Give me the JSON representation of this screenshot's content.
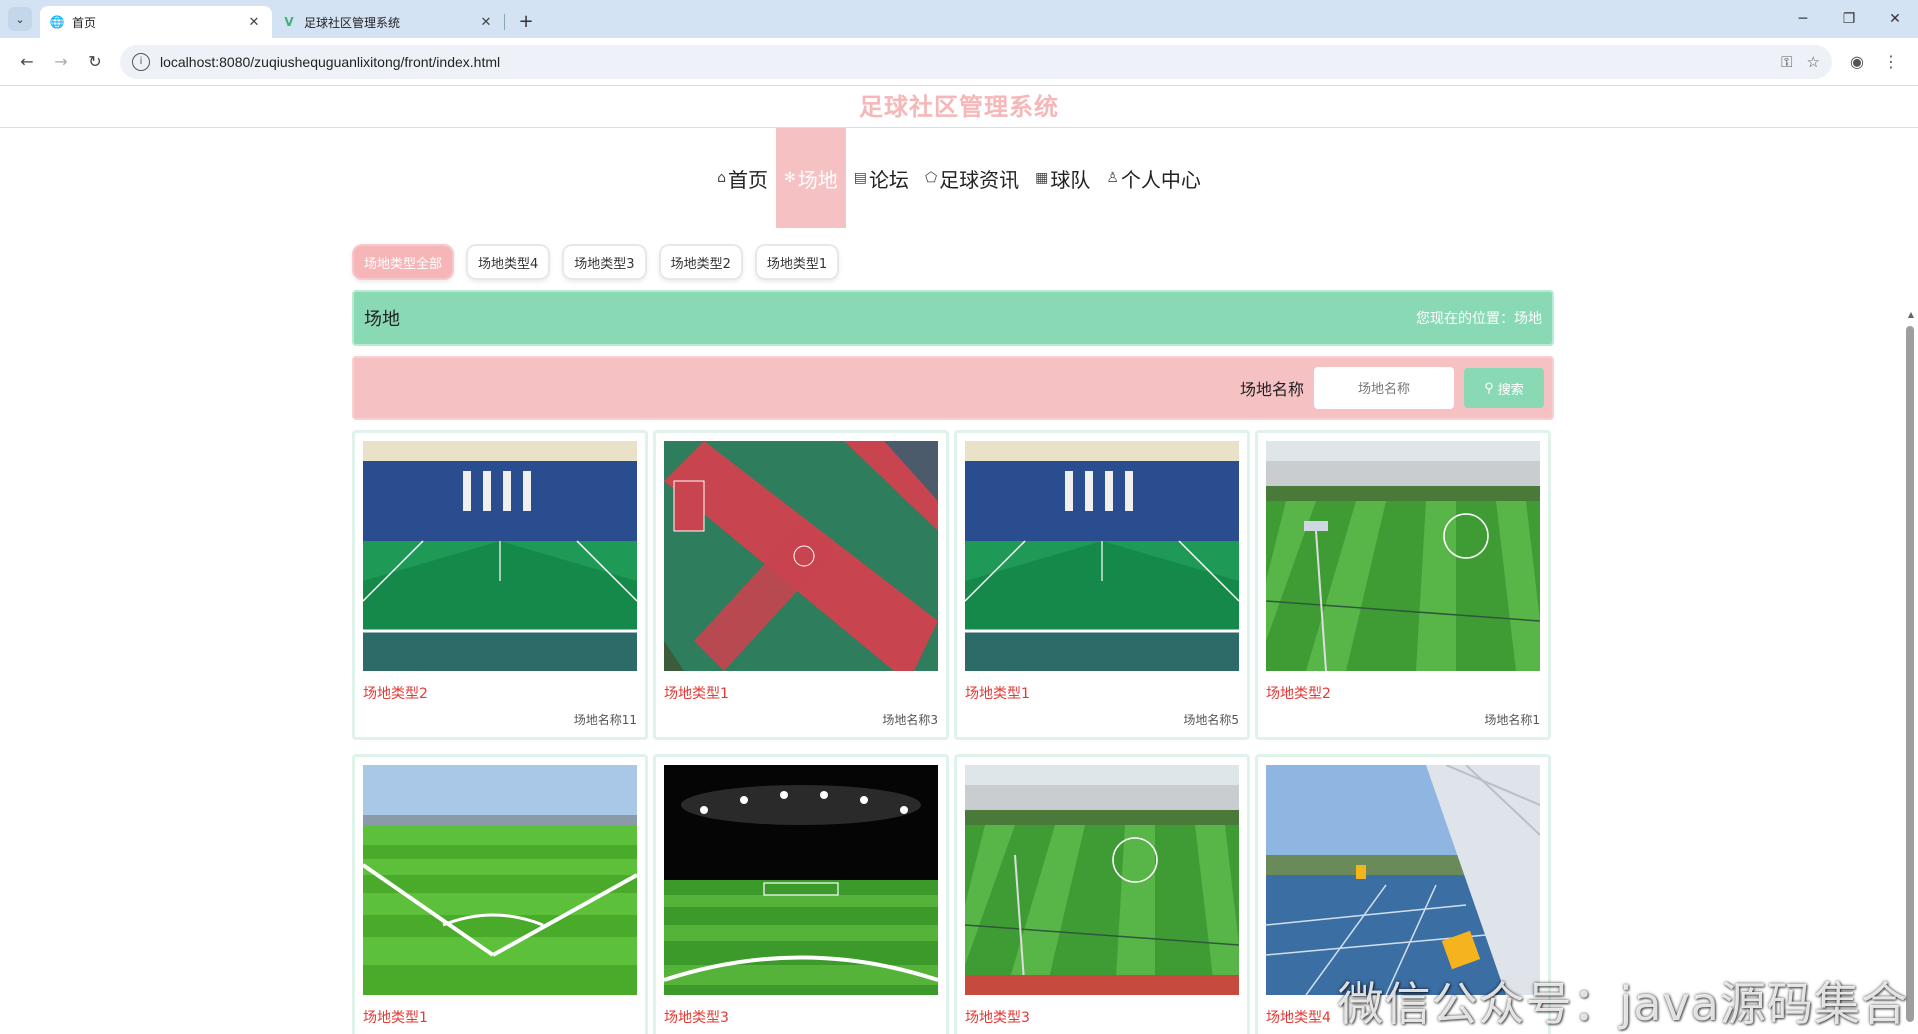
{
  "browser": {
    "tabs": [
      {
        "title": "首页",
        "icon": "globe-icon",
        "active": true
      },
      {
        "title": "足球社区管理系统",
        "icon": "vue-icon",
        "active": false
      }
    ],
    "url": "localhost:8080/zuqiushequguanlixitong/front/index.html"
  },
  "site": {
    "title": "足球社区管理系统",
    "nav": [
      {
        "label": "首页",
        "icon": "home-icon",
        "active": false
      },
      {
        "label": "场地",
        "icon": "snowflake-icon",
        "active": true
      },
      {
        "label": "论坛",
        "icon": "forum-icon",
        "active": false
      },
      {
        "label": "足球资讯",
        "icon": "tag-icon",
        "active": false
      },
      {
        "label": "球队",
        "icon": "team-icon",
        "active": false
      },
      {
        "label": "个人中心",
        "icon": "user-icon",
        "active": false
      }
    ]
  },
  "filters": [
    "场地类型全部",
    "场地类型4",
    "场地类型3",
    "场地类型2",
    "场地类型1"
  ],
  "breadcrumb": {
    "title": "场地",
    "location": "您现在的位置：场地"
  },
  "search": {
    "label": "场地名称",
    "placeholder": "场地名称",
    "button": "搜索"
  },
  "cards": [
    {
      "type": "场地类型2",
      "name": "场地名称11",
      "image": "indoor-field"
    },
    {
      "type": "场地类型1",
      "name": "场地名称3",
      "image": "aerial-court"
    },
    {
      "type": "场地类型1",
      "name": "场地名称5",
      "image": "indoor-field"
    },
    {
      "type": "场地类型2",
      "name": "场地名称1",
      "image": "outdoor-field"
    },
    {
      "type": "场地类型1",
      "name": "",
      "image": "grass-corner"
    },
    {
      "type": "场地类型3",
      "name": "",
      "image": "night-stadium"
    },
    {
      "type": "场地类型3",
      "name": "",
      "image": "outdoor-field"
    },
    {
      "type": "场地类型4",
      "name": "",
      "image": "blue-court"
    }
  ],
  "watermark": "微信公众号：java源码集合"
}
